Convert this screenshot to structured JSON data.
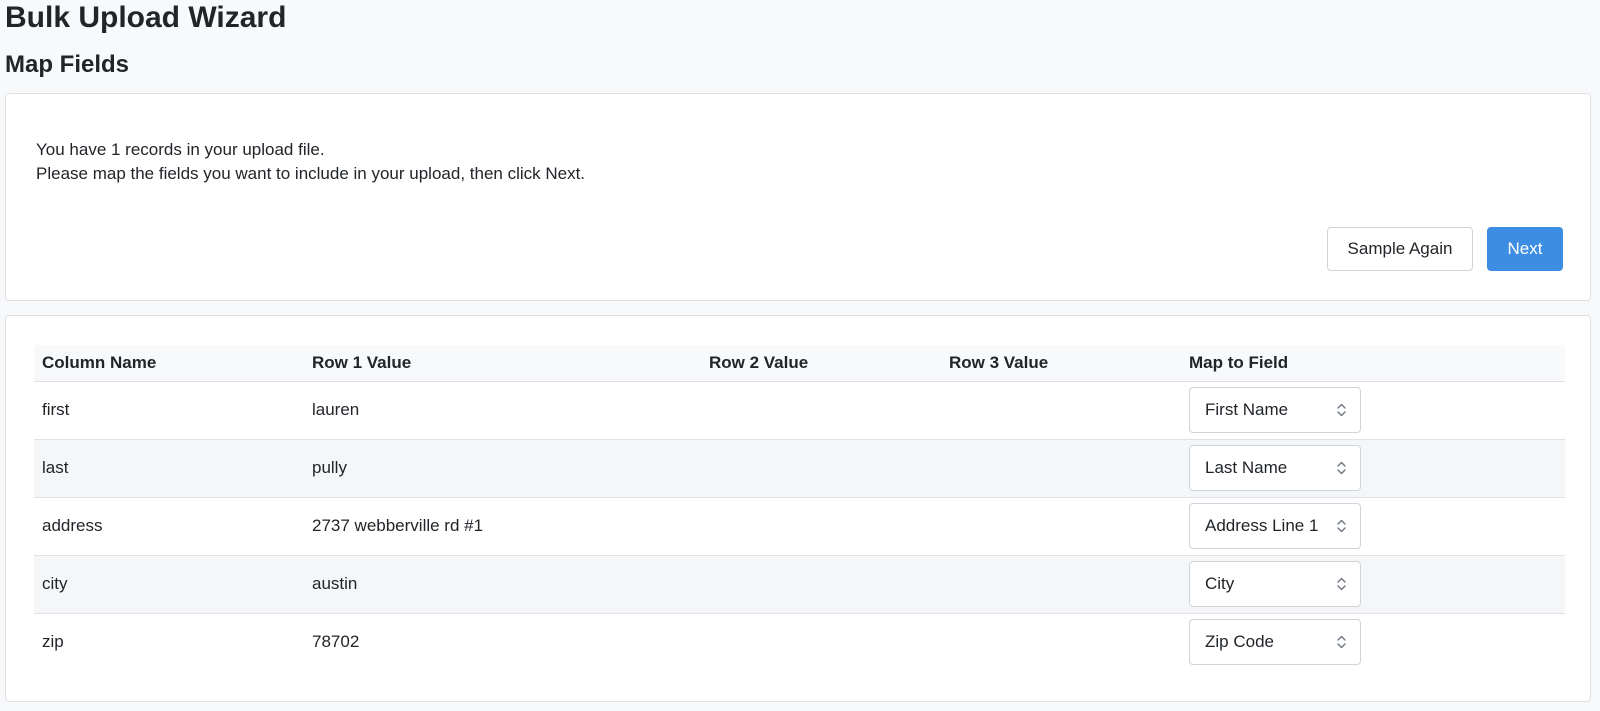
{
  "page": {
    "title": "Bulk Upload Wizard",
    "step_title": "Map Fields"
  },
  "info": {
    "line1": "You have 1 records in your upload file.",
    "line2": "Please map the fields you want to include in your upload, then click Next."
  },
  "buttons": {
    "sample_again": "Sample Again",
    "next": "Next"
  },
  "table": {
    "headers": {
      "column_name": "Column Name",
      "row1": "Row 1 Value",
      "row2": "Row 2 Value",
      "row3": "Row 3 Value",
      "map": "Map to Field"
    },
    "rows": [
      {
        "column": "first",
        "row1": "lauren",
        "row2": "",
        "row3": "",
        "field": "First Name"
      },
      {
        "column": "last",
        "row1": "pully",
        "row2": "",
        "row3": "",
        "field": "Last Name"
      },
      {
        "column": "address",
        "row1": "2737 webberville rd #1",
        "row2": "",
        "row3": "",
        "field": "Address Line 1"
      },
      {
        "column": "city",
        "row1": "austin",
        "row2": "",
        "row3": "",
        "field": "City"
      },
      {
        "column": "zip",
        "row1": "78702",
        "row2": "",
        "row3": "",
        "field": "Zip Code"
      }
    ]
  },
  "colors": {
    "primary": "#3d8ee3",
    "background": "#f8f9fa",
    "stripe": "#f5f6f8"
  },
  "icons": {
    "select_arrow": "chevron-up-down-icon"
  }
}
